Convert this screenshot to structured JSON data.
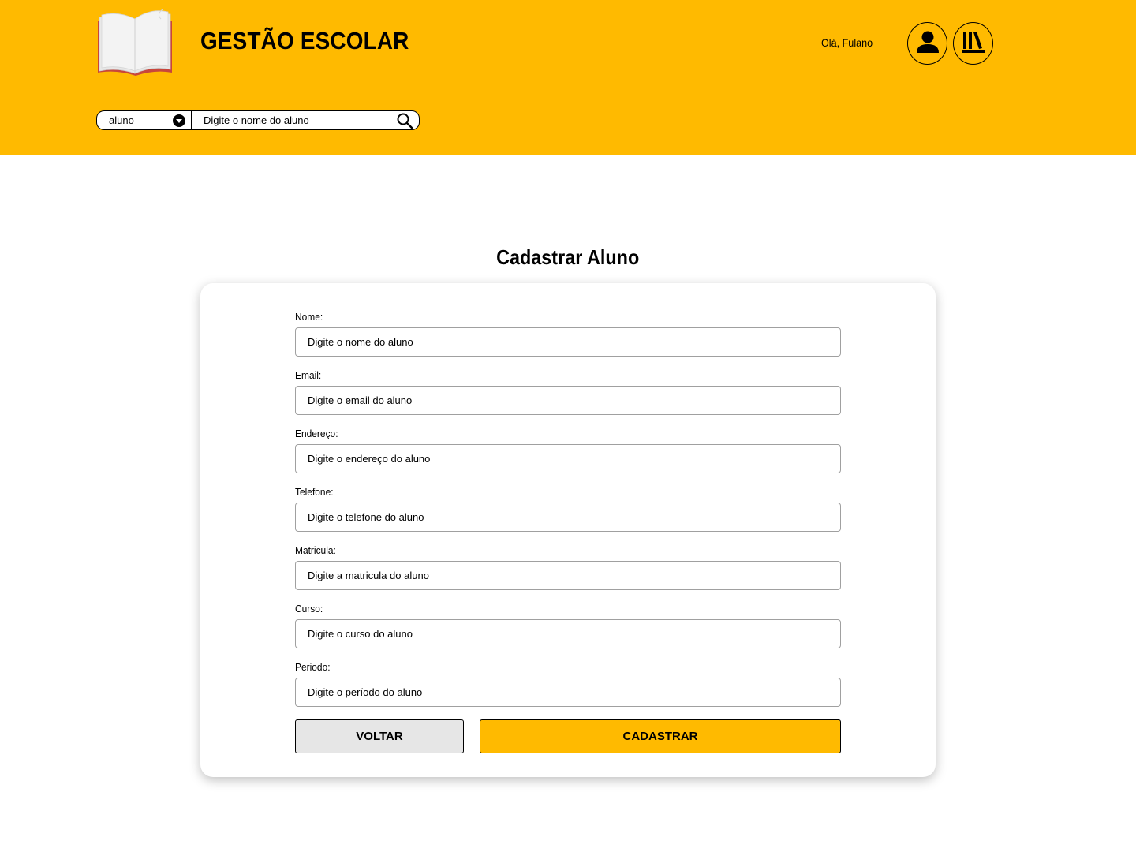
{
  "colors": {
    "accent": "#FFBA00",
    "back_button": "#E6E6E6",
    "background": "#FFFFFF",
    "logo_cover": "#C8463C"
  },
  "header": {
    "logo_icon": "open-book-icon",
    "title": "GESTÃO ESCOLAR",
    "greeting": "Olá, Fulano",
    "profile_icon": "user-icon",
    "library_icon": "library-books-icon"
  },
  "search": {
    "type_selected": "aluno",
    "dropdown_icon": "chevron-down-circle-icon",
    "placeholder": "Digite o nome do aluno",
    "search_icon": "search-icon"
  },
  "page": {
    "title": "Cadastrar Aluno"
  },
  "form": {
    "fields": [
      {
        "label": "Nome:",
        "placeholder": "Digite o nome do aluno",
        "value": ""
      },
      {
        "label": "Email:",
        "placeholder": "Digite o email do aluno",
        "value": ""
      },
      {
        "label": "Endereço:",
        "placeholder": "Digite o endereço do aluno",
        "value": ""
      },
      {
        "label": "Telefone:",
        "placeholder": "Digite o telefone do aluno",
        "value": ""
      },
      {
        "label": "Matricula:",
        "placeholder": "Digite a matricula do aluno",
        "value": ""
      },
      {
        "label": "Curso:",
        "placeholder": "Digite o curso do aluno",
        "value": ""
      },
      {
        "label": "Periodo:",
        "placeholder": "Digite o período do aluno",
        "value": ""
      }
    ],
    "back_label": "VOLTAR",
    "submit_label": "CADASTRAR"
  }
}
